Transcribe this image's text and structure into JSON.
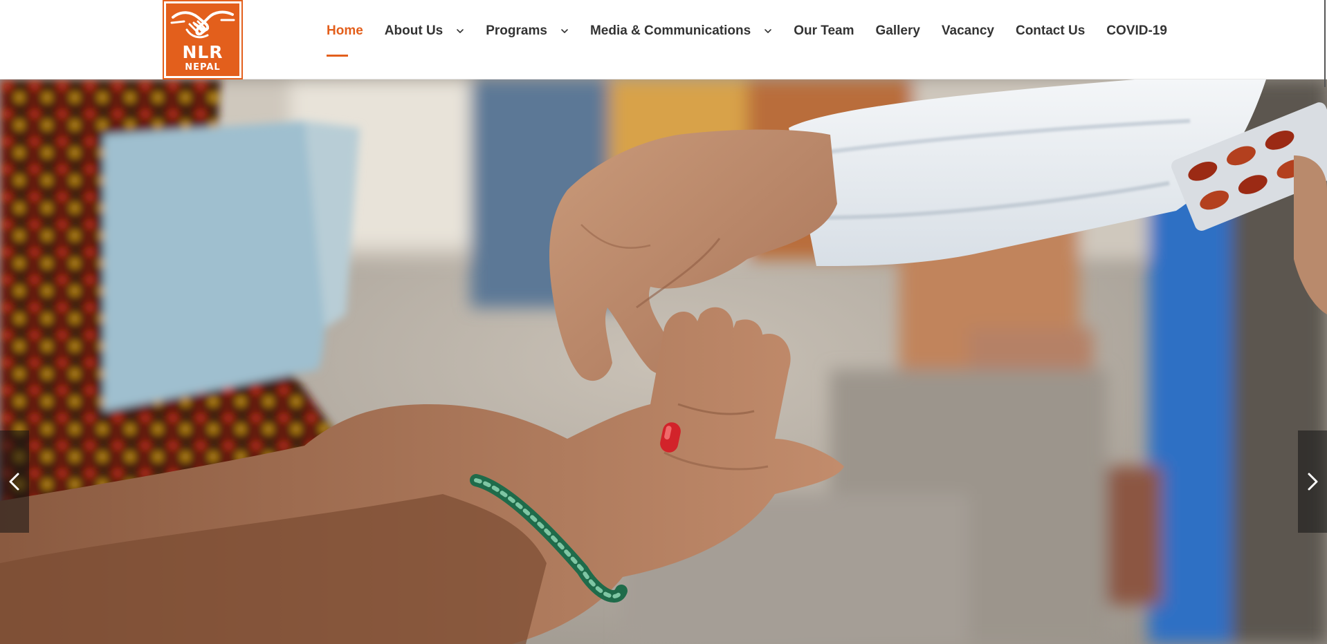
{
  "brand": {
    "logo_text": "NLR",
    "logo_subtext": "NEPAL",
    "accent_color": "#e35f1c",
    "logo_icon": "handshake-icon"
  },
  "nav": {
    "items": [
      {
        "label": "Home",
        "active": true,
        "has_dropdown": false
      },
      {
        "label": "About Us",
        "active": false,
        "has_dropdown": true
      },
      {
        "label": "Programs",
        "active": false,
        "has_dropdown": true
      },
      {
        "label": "Media & Communications",
        "active": false,
        "has_dropdown": true
      },
      {
        "label": "Our Team",
        "active": false,
        "has_dropdown": false
      },
      {
        "label": "Gallery",
        "active": false,
        "has_dropdown": false
      },
      {
        "label": "Vacancy",
        "active": false,
        "has_dropdown": false
      },
      {
        "label": "Contact Us",
        "active": false,
        "has_dropdown": false
      },
      {
        "label": "COVID-19",
        "active": false,
        "has_dropdown": false
      }
    ]
  },
  "slider": {
    "prev_icon": "chevron-left-icon",
    "next_icon": "chevron-right-icon"
  }
}
